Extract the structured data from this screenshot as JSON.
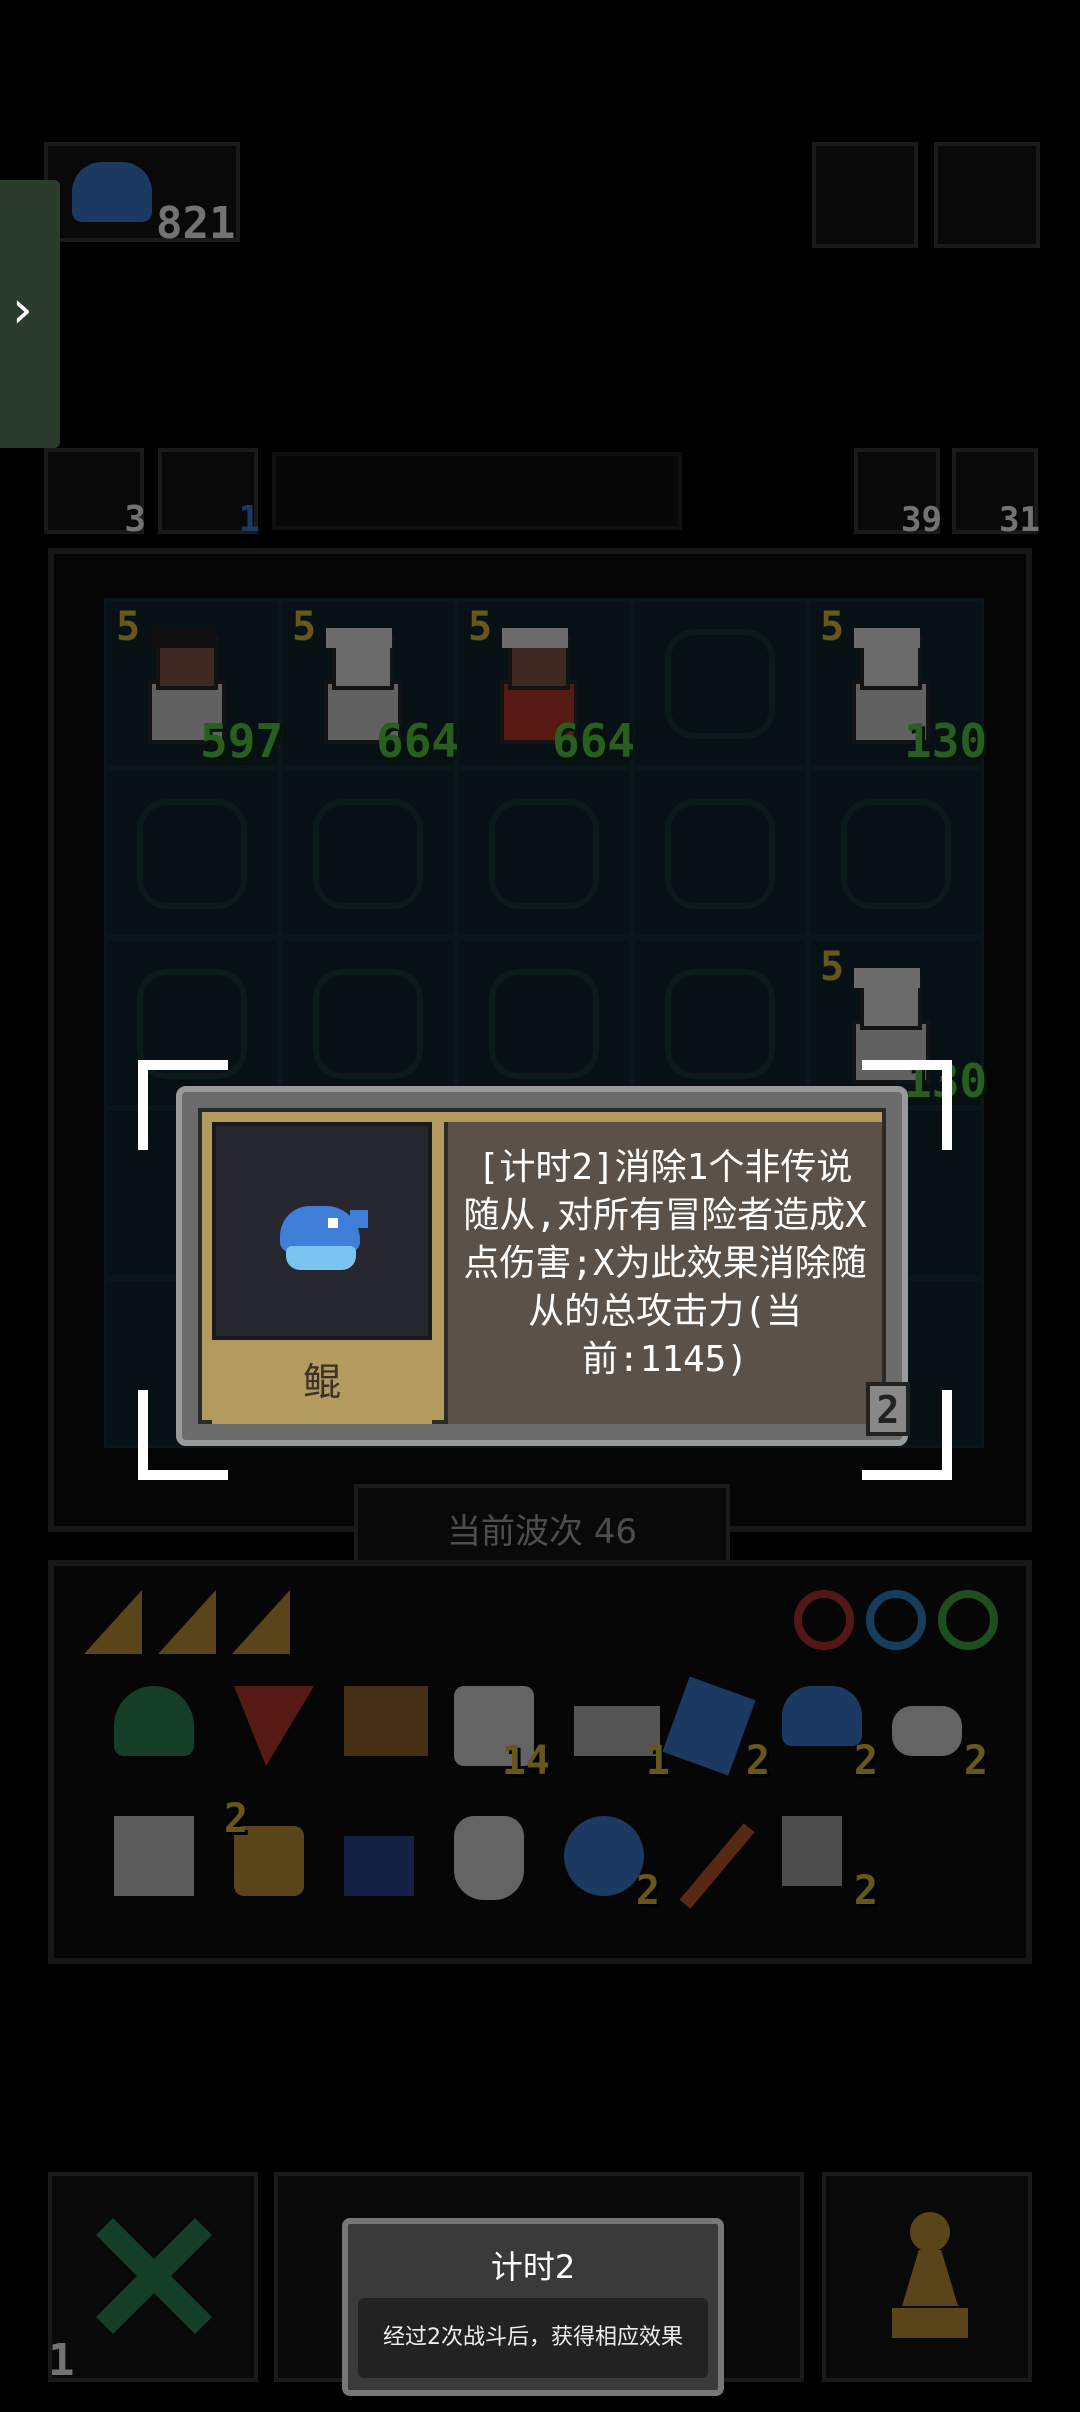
{
  "top_bar": {
    "currency_value": "821"
  },
  "side_tab": {
    "arrow": "›"
  },
  "resources": {
    "res1_count": "3",
    "res2_count": "1",
    "res3_count": "39",
    "res4_count": "31"
  },
  "board": {
    "units": [
      {
        "level": "5",
        "attack": "597"
      },
      {
        "level": "5",
        "attack": "664"
      },
      {
        "level": "5",
        "attack": "664"
      },
      {
        "level": "5",
        "attack": "130"
      },
      {
        "level": "5",
        "attack": "130"
      }
    ],
    "wave_label": "当前波次 46"
  },
  "card": {
    "item_name": "鲲",
    "description": "[计时2]消除1个非传说随从,对所有冒险者造成X点伤害;X为此效果消除随从的总攻击力(当前:1145)",
    "badge_number": "2"
  },
  "inventory": {
    "row1_counts": [
      "",
      "",
      "",
      "14",
      "1",
      "2",
      "2",
      "2"
    ],
    "row2_counts": [
      "",
      "2",
      "",
      "",
      "2",
      "",
      "2"
    ]
  },
  "bottom": {
    "left_count": "1"
  },
  "tooltip": {
    "title": "计时2",
    "body": "经过2次战斗后，获得相应效果"
  },
  "colors": {
    "card_gold": "#b39a5e",
    "card_brown": "#5c5148",
    "item_blue": "#3f7fd8",
    "accent_green": "#59d046",
    "accent_yellow": "#e6c23a"
  }
}
